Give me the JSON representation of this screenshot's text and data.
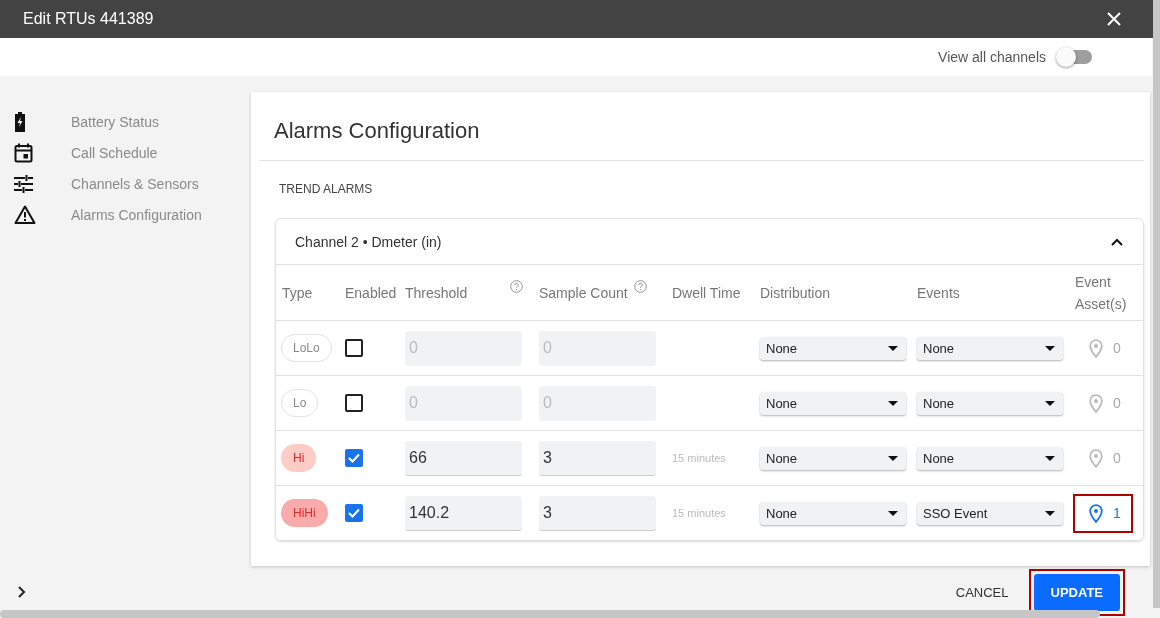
{
  "window": {
    "title": "Edit RTUs 441389"
  },
  "toolbar": {
    "toggle_label": "View all channels",
    "toggle_on": false
  },
  "sidebar": {
    "items": [
      {
        "label": "Battery Status"
      },
      {
        "label": "Call Schedule"
      },
      {
        "label": "Channels & Sensors"
      },
      {
        "label": "Alarms Configuration"
      }
    ]
  },
  "panel": {
    "title": "Alarms Configuration",
    "section": "TREND ALARMS",
    "card": {
      "title": "Channel 2 • Dmeter (in)",
      "expanded": true,
      "columns": [
        {
          "label": "Type",
          "help": false
        },
        {
          "label": "Enabled",
          "help": false
        },
        {
          "label": "Threshold",
          "help": true
        },
        {
          "label": "Sample Count",
          "help": true
        },
        {
          "label": "Dwell Time",
          "help": false
        },
        {
          "label": "Distribution",
          "help": false
        },
        {
          "label": "Events",
          "help": false
        },
        {
          "label": "Event Asset(s)",
          "help": false
        }
      ],
      "rows": [
        {
          "type": "LoLo",
          "color": "#ffffff",
          "enabled": false,
          "threshold": "0",
          "sample_count": "0",
          "distribution": "None",
          "events": "None",
          "assets": "0",
          "highlighted": false
        },
        {
          "type": "Lo",
          "color": "#ffffff",
          "enabled": false,
          "threshold": "0",
          "sample_count": "0",
          "distribution": "None",
          "events": "None",
          "assets": "0",
          "highlighted": false
        },
        {
          "type": "Hi",
          "color": "#fdccc6",
          "enabled": true,
          "threshold": "66",
          "sample_count": "3",
          "dwell_time": "15 minutes",
          "distribution": "None",
          "events": "None",
          "assets": "0",
          "highlighted": false
        },
        {
          "type": "HiHi",
          "color": "#f9aaab",
          "enabled": true,
          "threshold": "140.2",
          "sample_count": "3",
          "dwell_time": "15 minutes",
          "distribution": "None",
          "events": "SSO Event",
          "assets": "1",
          "highlighted": true
        }
      ]
    }
  },
  "footer": {
    "cancel": "CANCEL",
    "update": "UPDATE",
    "update_highlighted": true
  }
}
